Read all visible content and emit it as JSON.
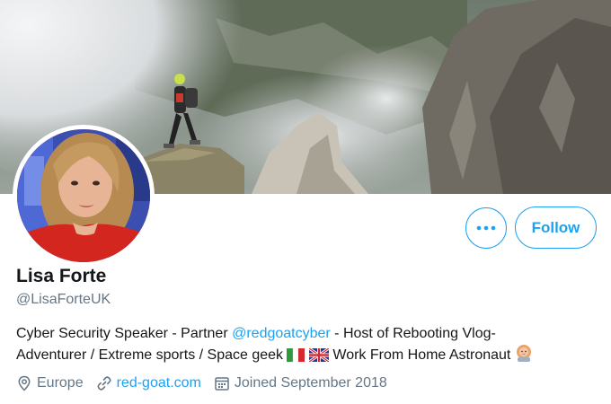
{
  "profile": {
    "display_name": "Lisa Forte",
    "handle": "@LisaForteUK"
  },
  "actions": {
    "more_icon": "more-horizontal-icon",
    "follow_label": "Follow"
  },
  "bio": {
    "text_1": "Cyber Security Speaker - Partner ",
    "mention": "@redgoatcyber",
    "text_2": " - Host of Rebooting Vlog-",
    "line_2_text_1": "Adventurer / Extreme sports  / Space geek ",
    "line_2_text_2": " Work From Home Astronaut "
  },
  "meta": {
    "location": "Europe",
    "website": "red-goat.com",
    "joined": "Joined September 2018"
  },
  "colors": {
    "accent": "#1da1f2",
    "secondary_text": "#657786",
    "primary_text": "#14171a"
  }
}
